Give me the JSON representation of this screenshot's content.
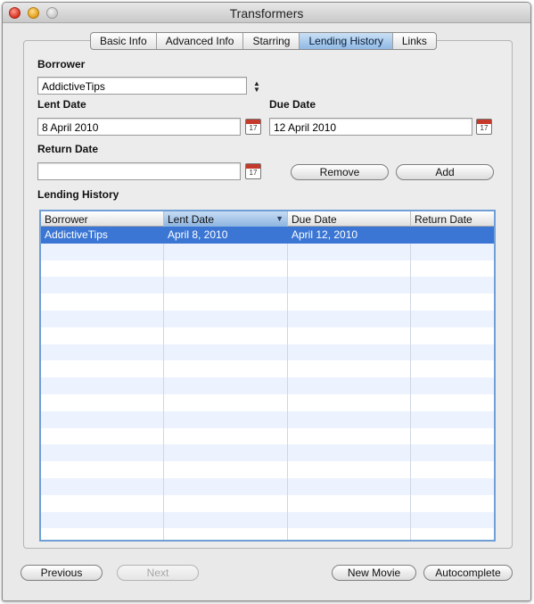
{
  "window": {
    "title": "Transformers"
  },
  "tabs": [
    {
      "label": "Basic Info"
    },
    {
      "label": "Advanced Info"
    },
    {
      "label": "Starring"
    },
    {
      "label": "Lending History",
      "active": true
    },
    {
      "label": "Links"
    }
  ],
  "form": {
    "borrower_label": "Borrower",
    "borrower_value": "AddictiveTips",
    "lent_date_label": "Lent Date",
    "lent_date_value": "8 April 2010",
    "due_date_label": "Due Date",
    "due_date_value": "12 April 2010",
    "return_date_label": "Return Date",
    "return_date_value": "",
    "remove_label": "Remove",
    "add_label": "Add",
    "calendar_day": "17"
  },
  "history": {
    "label": "Lending History",
    "columns": [
      "Borrower",
      "Lent Date",
      "Due Date",
      "Return Date"
    ],
    "sorted_column": "Lent Date",
    "rows": [
      [
        "AddictiveTips",
        "April 8, 2010",
        "April 12, 2010",
        ""
      ]
    ],
    "selected_row": 0
  },
  "footer": {
    "previous_label": "Previous",
    "next_label": "Next",
    "new_movie_label": "New Movie",
    "autocomplete_label": "Autocomplete"
  },
  "colors": {
    "selection": "#3b76d4",
    "alt_row": "#edf3fe",
    "table_focus_ring": "#6f9fd6"
  }
}
